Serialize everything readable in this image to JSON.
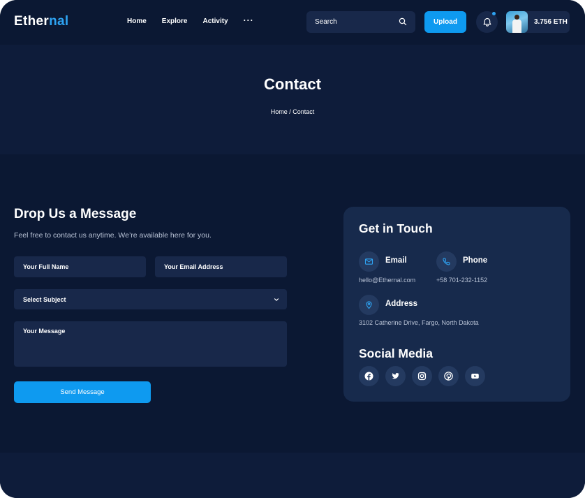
{
  "header": {
    "logo_main": "Ether",
    "logo_accent": "nal",
    "nav": [
      "Home",
      "Explore",
      "Activity",
      "···"
    ],
    "search_placeholder": "Search",
    "upload_label": "Upload",
    "balance": "3.756 ETH"
  },
  "banner": {
    "title": "Contact",
    "breadcrumb": "Home / Contact"
  },
  "form": {
    "title": "Drop Us a Message",
    "subtitle": "Feel free to contact us anytime. We’re available here for you.",
    "name_placeholder": "Your Full Name",
    "email_placeholder": "Your Email Address",
    "subject_value": "Select Subject",
    "message_placeholder": "Your Message",
    "send_label": "Send Message"
  },
  "card": {
    "title": "Get in Touch",
    "email_label": "Email",
    "email_value": "hello@Ethernal.com",
    "phone_label": "Phone",
    "phone_value": "+58 701-232-1152",
    "address_label": "Address",
    "address_value": "3102 Catherine Drive, Fargo, North Dakota",
    "social_title": "Social Media",
    "social_icons": [
      "facebook-icon",
      "twitter-icon",
      "instagram-icon",
      "pinterest-icon",
      "youtube-icon"
    ]
  },
  "colors": {
    "background": "#0b1833",
    "panel": "#172a4c",
    "field": "#18284a",
    "accent": "#0e9af0",
    "icon_blue": "#2ea3f2"
  }
}
